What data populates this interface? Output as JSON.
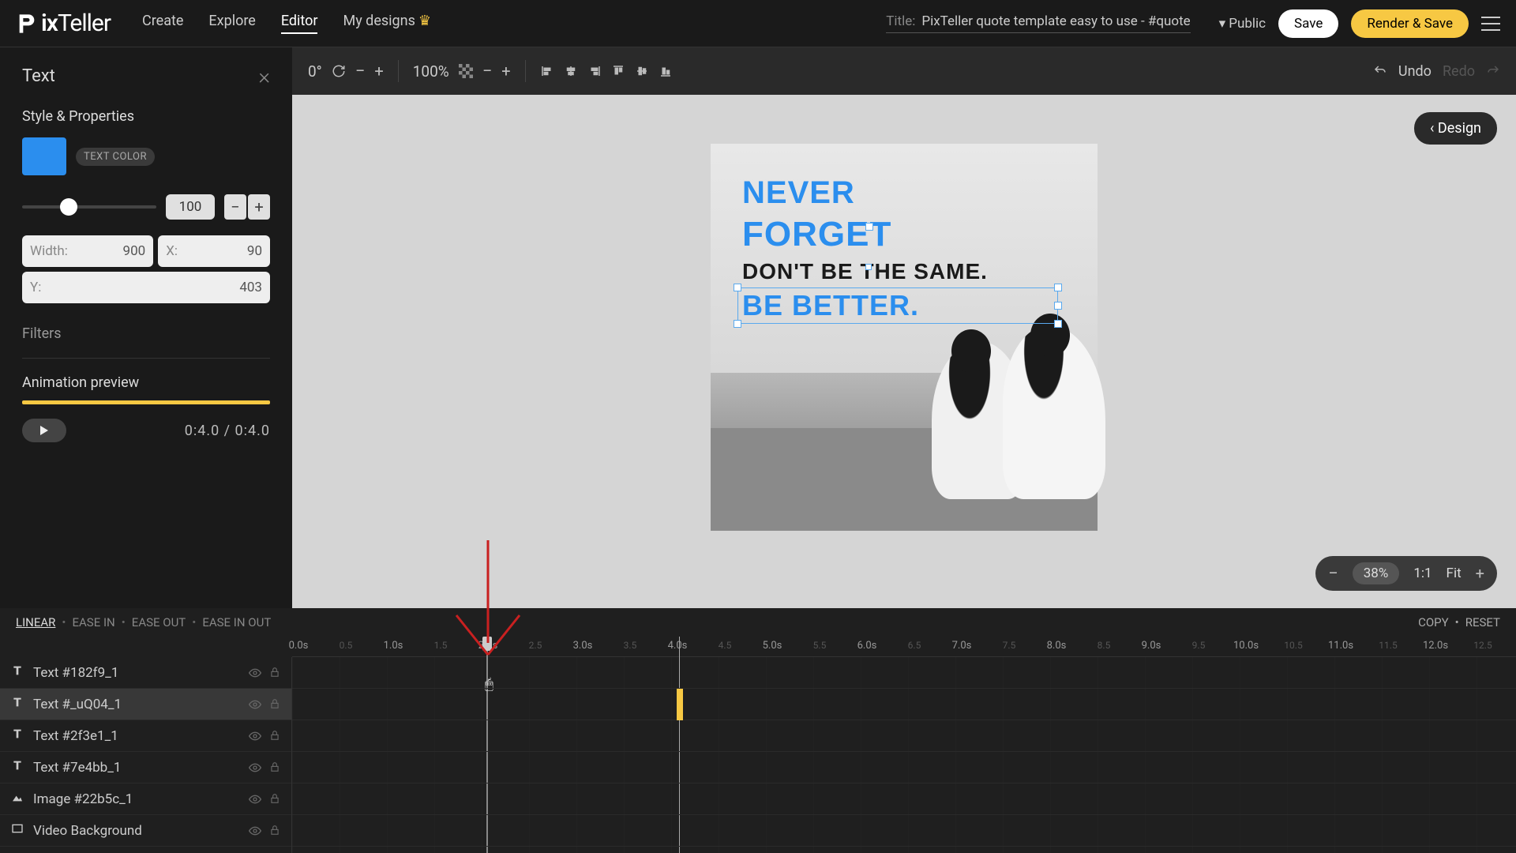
{
  "nav": {
    "logo": "PixTeller",
    "links": [
      "Create",
      "Explore",
      "Editor",
      "My designs"
    ],
    "active_index": 2,
    "title_label": "Title:",
    "title_text": "PixTeller quote template easy to use - #quote",
    "visibility": "Public",
    "save": "Save",
    "render": "Render & Save"
  },
  "panel": {
    "title": "Text",
    "style_properties": "Style & Properties",
    "text_color_label": "TEXT COLOR",
    "opacity_value": "100",
    "width_label": "Width:",
    "width_value": "900",
    "x_label": "X:",
    "x_value": "90",
    "y_label": "Y:",
    "y_value": "403",
    "filters": "Filters",
    "animation_preview": "Animation preview",
    "anim_time": "0:4.0 / 0:4.0"
  },
  "toolbar": {
    "rotation": "0°",
    "zoom": "100%",
    "undo": "Undo",
    "redo": "Redo"
  },
  "canvas": {
    "design_btn": "Design",
    "quote": {
      "line1": "NEVER",
      "line2": "FORGET",
      "line3": "DON'T BE THE SAME.",
      "line4": "BE BETTER."
    },
    "zoom_pct": "38%",
    "zoom_ratio": "1:1",
    "zoom_fit": "Fit"
  },
  "timeline": {
    "easings": [
      "LINEAR",
      "EASE IN",
      "EASE OUT",
      "EASE IN OUT"
    ],
    "active_easing": 0,
    "copy": "COPY",
    "reset": "RESET",
    "marks": [
      "0.0s",
      "0.5",
      "1.0s",
      "1.5",
      "2.0s",
      "2.5",
      "3.0s",
      "3.5",
      "4.0s",
      "4.5",
      "5.0s",
      "5.5",
      "6.0s",
      "6.5",
      "7.0s",
      "7.5",
      "8.0s",
      "8.5",
      "9.0s",
      "9.5",
      "10.0s",
      "10.5",
      "11.0s",
      "11.5",
      "12.0s",
      "12.5"
    ],
    "layers": [
      {
        "name": "Text #182f9_1",
        "type": "text"
      },
      {
        "name": "Text #_uQ04_1",
        "type": "text",
        "selected": true
      },
      {
        "name": "Text #2f3e1_1",
        "type": "text"
      },
      {
        "name": "Text #7e4bb_1",
        "type": "text"
      },
      {
        "name": "Image #22b5c_1",
        "type": "image"
      },
      {
        "name": "Video Background",
        "type": "video"
      }
    ]
  }
}
